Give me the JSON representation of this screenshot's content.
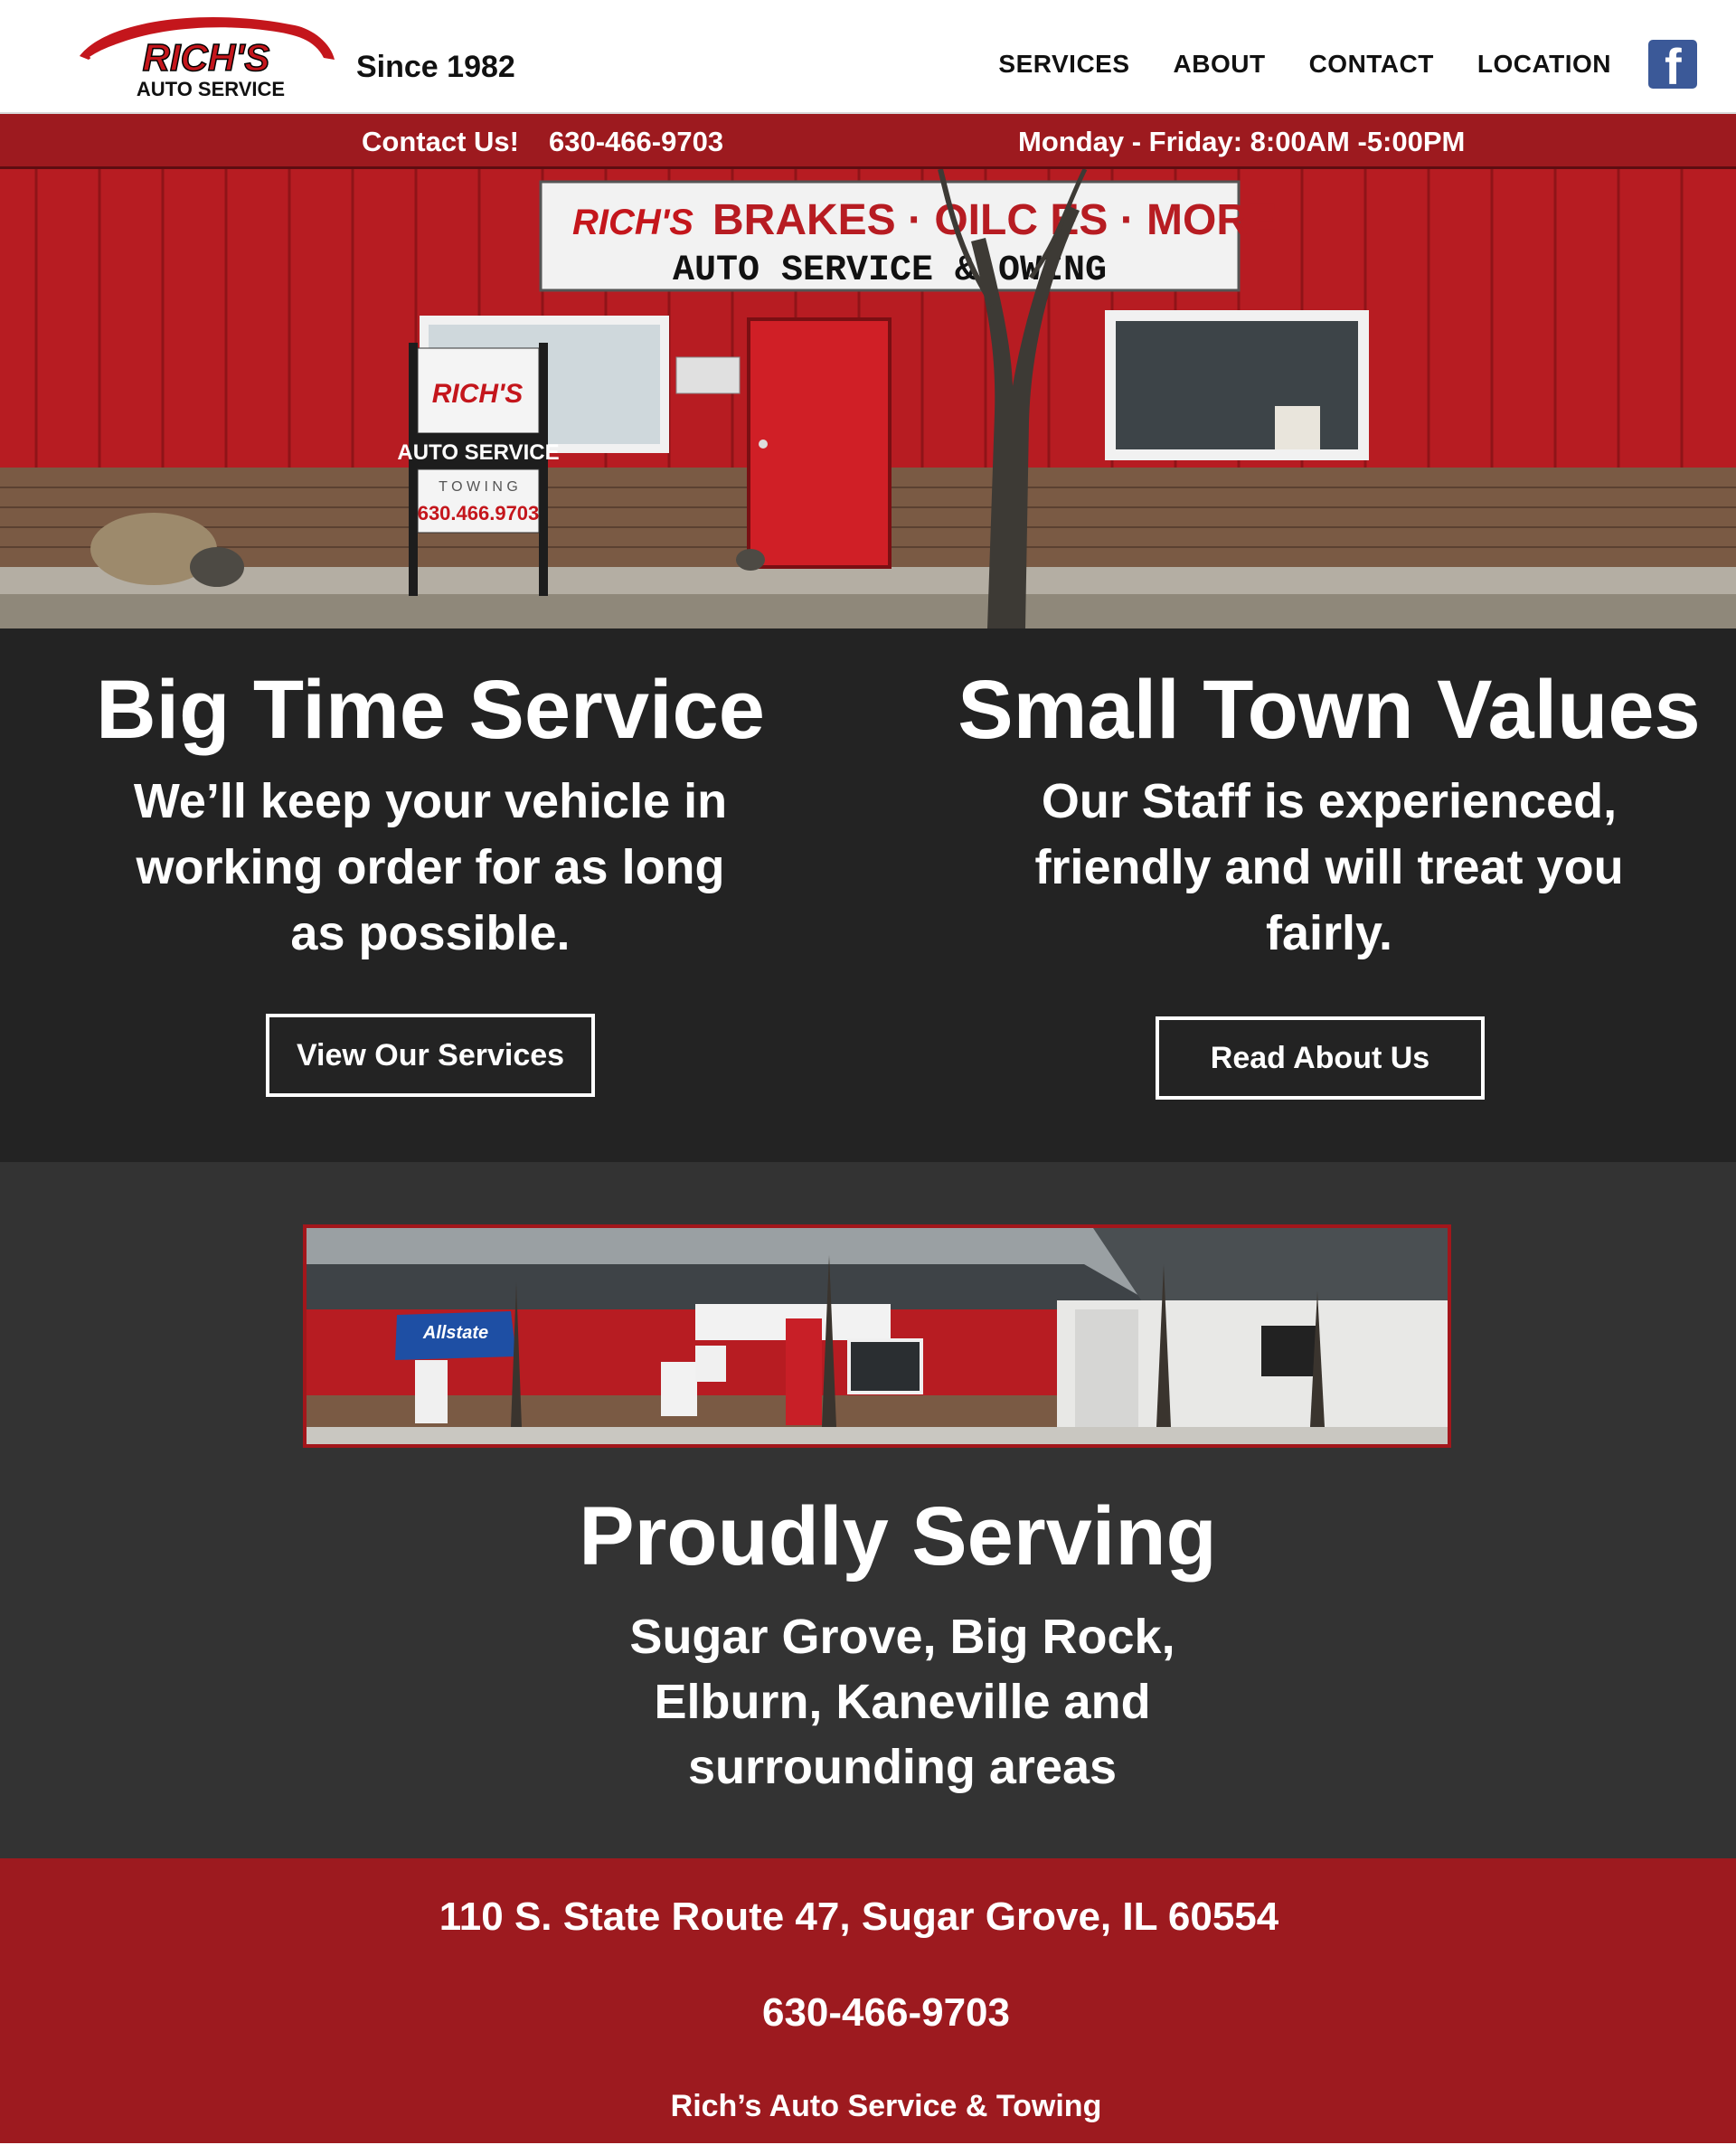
{
  "header": {
    "logo_text_top": "RICH'S",
    "logo_text_bottom": "AUTO SERVICE",
    "since": "Since 1982",
    "nav": [
      "SERVICES",
      "ABOUT",
      "CONTACT",
      "LOCATION"
    ],
    "social_icon": "facebook-icon"
  },
  "infobar": {
    "contact_label": "Contact Us!",
    "phone": "630-466-9703",
    "hours": "Monday - Friday: 8:00AM -5:00PM"
  },
  "hero": {
    "sign_brand": "RICH'S",
    "sign_line1": "BRAKES · OILC   ES · MORE",
    "sign_line2": "AUTO SERVICE &   OWING",
    "yard_sign_brand": "RICH'S",
    "yard_sign_service": "AUTO SERVICE",
    "yard_sign_towing": "T O W I N G",
    "yard_sign_phone": "630.466.9703"
  },
  "taglines": {
    "left": {
      "title": "Big Time Service",
      "body": "We’ll keep your vehicle in working order for as long as possible.",
      "button": "View Our Services"
    },
    "right": {
      "title": "Small Town Values",
      "body": "Our Staff is experienced, friendly and will treat you fairly.",
      "button": "Read About Us"
    }
  },
  "serving": {
    "awning_text": "Allstate",
    "title": "Proudly Serving",
    "lines": [
      "Sugar Grove, Big Rock,",
      "Elburn, Kaneville and",
      "surrounding areas"
    ]
  },
  "footer": {
    "address": "110 S. State Route 47, Sugar Grove, IL 60554",
    "phone": "630-466-9703",
    "business_name": "Rich’s Auto Service & Towing"
  },
  "colors": {
    "brand_red": "#9d1a1f",
    "dark_band": "#232323",
    "mid_band": "#333333",
    "facebook_blue": "#3b5998"
  }
}
